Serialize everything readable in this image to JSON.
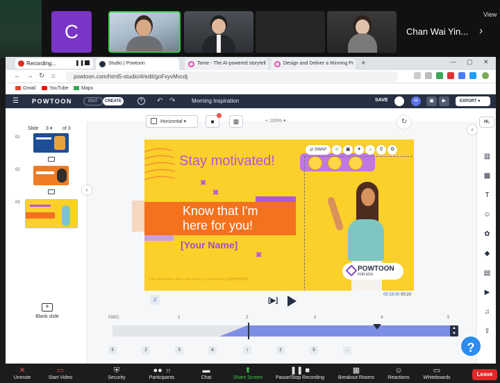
{
  "zoom_top": {
    "participant_initial": "C",
    "participant_name": "Chan Wai Yin...",
    "view_label": "View"
  },
  "browser": {
    "recording_tab": "Recording...",
    "tabs": [
      {
        "label": "Studio | Powtoon"
      },
      {
        "label": "Tome - The AI-powered storytell"
      },
      {
        "label": "Design and Deliver a Winning Pr"
      }
    ],
    "url": "powtoon.com/html5-studio/#/edit/goFxyvMxcdj",
    "bookmarks": [
      "Gmail",
      "YouTube",
      "Maps"
    ]
  },
  "powtoon": {
    "logo": "POWTOON",
    "edit_label": "EDIT",
    "create_label": "CREATE",
    "project_title": "Morning Inspiration",
    "save_label": "SAVE",
    "export_label": "EXPORT",
    "avatar_initial": "H"
  },
  "slides": {
    "label": "Slide",
    "current": "3",
    "of_label": "of 3",
    "items": [
      {
        "index": "01"
      },
      {
        "index": "02"
      },
      {
        "index": "03"
      }
    ],
    "blank_label": "Blank slide"
  },
  "canvas_toolbar": {
    "orientation": "Horizontal",
    "zoom_label": "+ 100%"
  },
  "canvas": {
    "headline": "Stay motivated!",
    "body_line1": "Know that I'm",
    "body_line2": "here for you!",
    "name_placeholder": "[Your Name]",
    "credit": "This awesome video was easily created using",
    "credit_brand": "POWTOON",
    "badge_title": "POWTOON",
    "badge_sub": "FOR EDU",
    "swap_label": "SWAP"
  },
  "playback": {
    "time_current": "00:19:00",
    "time_total": "00:20",
    "scene_label": "[▶]"
  },
  "timeline": {
    "ticks": [
      "0SEC",
      "1",
      "2",
      "3",
      "4",
      "5"
    ],
    "items": [
      "5",
      "2",
      "3",
      "6",
      "i",
      "2",
      "5",
      "..."
    ]
  },
  "right_panel": {
    "hi_label": "Hi,"
  },
  "help_label": "?",
  "zoom_bottom": {
    "buttons": [
      {
        "label": "Unmute"
      },
      {
        "label": "Start Video"
      },
      {
        "label": "Security"
      },
      {
        "label": "Participants"
      },
      {
        "label": "Chat"
      },
      {
        "label": "Share Screen"
      },
      {
        "label": "Pause/Stop Recording"
      },
      {
        "label": "Breakout Rooms"
      },
      {
        "label": "Reactions"
      },
      {
        "label": "Whiteboards"
      }
    ],
    "participant_count": "77",
    "leave_label": "Leave"
  }
}
